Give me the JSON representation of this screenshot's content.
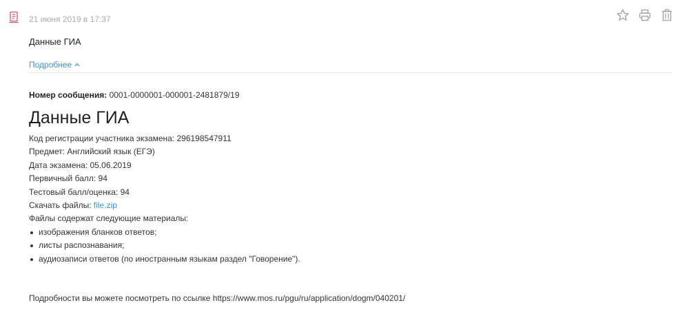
{
  "message": {
    "icon": "document-icon",
    "date": "21 июня 2019 в 17:37",
    "subject": "Данные ГИА",
    "details_label": "Подробнее",
    "actions": {
      "favorite": "star-icon",
      "print": "printer-icon",
      "delete": "trash-icon"
    }
  },
  "body": {
    "number_label": "Номер сообщения:",
    "number_value": "0001-0000001-000001-2481879/19",
    "title": "Данные ГИА",
    "rows": [
      "Код регистрации участника экзамена: 296198547911",
      "Предмет: Английский язык (ЕГЭ)",
      "Дата экзамена: 05.06.2019",
      "Первичный балл: 94",
      "Тестовый балл/оценка: 94"
    ],
    "download_label": "Скачать файлы:",
    "download_file": "file.zip",
    "materials_label": "Файлы содержат следующие материалы:",
    "materials": [
      "изображения бланков ответов;",
      "листы распознавания;",
      "аудиозаписи ответов (по иностранным языкам раздел \"Говорение\")."
    ],
    "footer": "Подробности вы можете посмотреть по ссылке https://www.mos.ru/pgu/ru/application/dogm/040201/"
  },
  "colors": {
    "link": "#3f8fcc",
    "icon_pink": "#c25a86",
    "muted": "#a9aab0"
  }
}
